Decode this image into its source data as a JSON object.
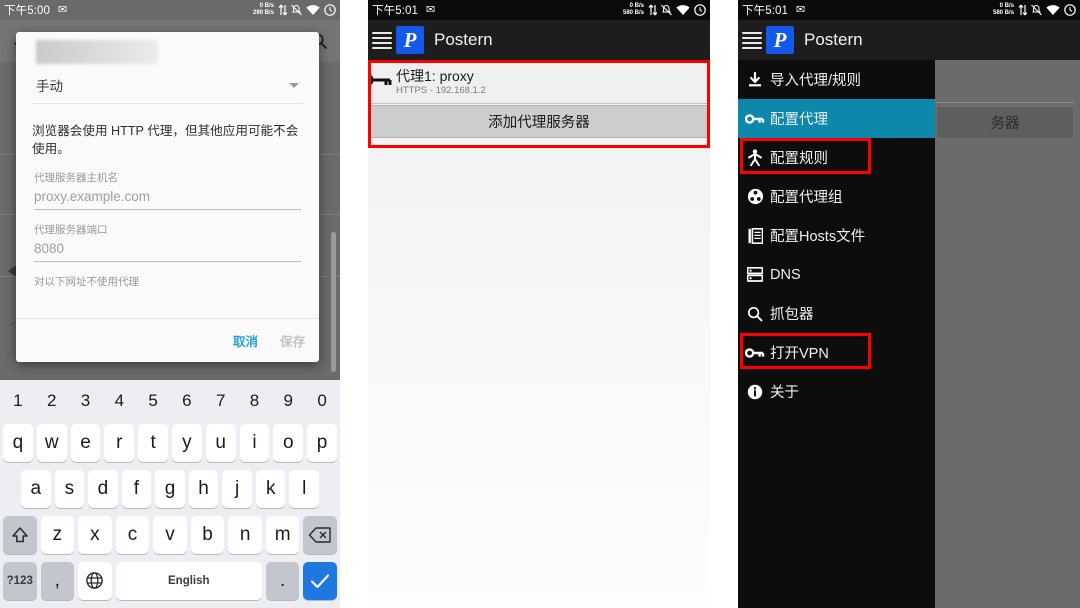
{
  "panel1": {
    "statusbar": {
      "time": "下午5:00",
      "mail_icon": "mail-icon",
      "rate_up": "0 B/s",
      "rate_down": "290 B/s",
      "icons": [
        "data-transfer-icon",
        "notifications-off-icon",
        "wifi-icon",
        "alarm-icon"
      ]
    },
    "toolbar": {
      "back_icon": "back-arrow-icon",
      "search_icon": "search-icon"
    },
    "dialog": {
      "redacted_title": "",
      "spinner_value": "手动",
      "note": "浏览器会使用 HTTP 代理，但其他应用可能不会使用。",
      "fields": [
        {
          "label": "代理服务器主机名",
          "value": "proxy.example.com"
        },
        {
          "label": "代理服务器端口",
          "value": "8080"
        },
        {
          "label": "对以下网址不使用代理",
          "value": ""
        }
      ],
      "cancel_label": "取消",
      "save_label": "保存"
    },
    "keyboard": {
      "numbers": [
        "1",
        "2",
        "3",
        "4",
        "5",
        "6",
        "7",
        "8",
        "9",
        "0"
      ],
      "row1": [
        "q",
        "w",
        "e",
        "r",
        "t",
        "y",
        "u",
        "i",
        "o",
        "p"
      ],
      "row2": [
        "a",
        "s",
        "d",
        "f",
        "g",
        "h",
        "j",
        "k",
        "l"
      ],
      "row3": [
        "z",
        "x",
        "c",
        "v",
        "b",
        "n",
        "m"
      ],
      "shift_icon": "shift-up-icon",
      "backspace_icon": "backspace-icon",
      "symbols_label": "?123",
      "comma_label": ",",
      "globe_icon": "globe-icon",
      "space_label": "English",
      "period_label": ".",
      "enter_icon": "check-icon"
    }
  },
  "panel2": {
    "statusbar": {
      "time": "下午5:01",
      "mail_icon": "mail-icon",
      "rate_up": "0 B/s",
      "rate_down": "580 B/s",
      "icons": [
        "data-transfer-icon",
        "notifications-off-icon",
        "wifi-icon",
        "alarm-icon"
      ]
    },
    "appbar": {
      "menu_icon": "hamburger-menu-icon",
      "logo_glyph": "P",
      "title": "Postern"
    },
    "proxy": {
      "icon": "key-icon",
      "name": "代理1: proxy",
      "detail": "HTTPS - 192.168.1.2"
    },
    "add_button": "添加代理服务器"
  },
  "panel3": {
    "statusbar": {
      "time": "下午5:01",
      "mail_icon": "mail-icon",
      "rate_up": "0 B/s",
      "rate_down": "580 B/s",
      "icons": [
        "data-transfer-icon",
        "notifications-off-icon",
        "wifi-icon",
        "alarm-icon"
      ]
    },
    "appbar": {
      "menu_icon": "hamburger-menu-icon",
      "logo_glyph": "P",
      "title": "Postern"
    },
    "behind_button_text": "务器",
    "drawer": {
      "items": [
        {
          "label": "导入代理/规则",
          "icon": "download-icon",
          "active": false,
          "highlighted": false
        },
        {
          "label": "配置代理",
          "icon": "key-icon",
          "active": true,
          "highlighted": false
        },
        {
          "label": "配置规则",
          "icon": "person-icon",
          "active": false,
          "highlighted": true
        },
        {
          "label": "配置代理组",
          "icon": "group-icon",
          "active": false,
          "highlighted": false
        },
        {
          "label": "配置Hosts文件",
          "icon": "file-icon",
          "active": false,
          "highlighted": false
        },
        {
          "label": "DNS",
          "icon": "server-icon",
          "active": false,
          "highlighted": false
        },
        {
          "label": "抓包器",
          "icon": "search-icon",
          "active": false,
          "highlighted": false
        },
        {
          "label": "打开VPN",
          "icon": "key-icon",
          "active": false,
          "highlighted": true
        },
        {
          "label": "关于",
          "icon": "info-icon",
          "active": false,
          "highlighted": false
        }
      ]
    }
  },
  "colors": {
    "accent_teal": "#0d87ac",
    "highlight_red": "#ff0000",
    "logo_blue": "#1559e8",
    "link_blue": "#28a2d8",
    "enter_blue": "#1f78e0"
  }
}
